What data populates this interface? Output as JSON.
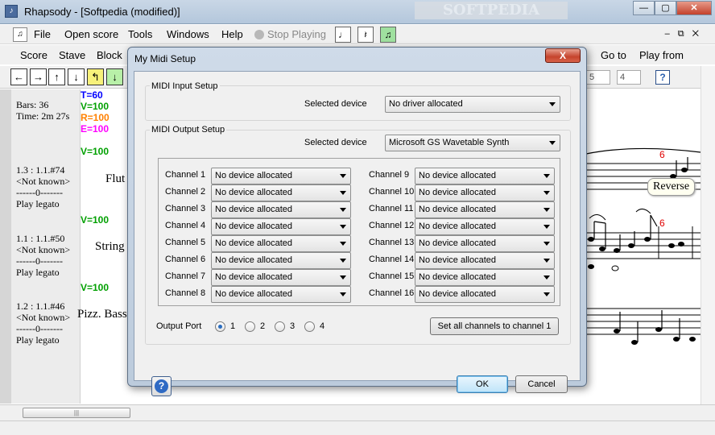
{
  "window": {
    "title": "Rhapsody - [Softpedia (modified)]",
    "watermark": "SOFTPEDIA"
  },
  "menubar": {
    "items": [
      "File",
      "Open score",
      "Tools",
      "Windows",
      "Help"
    ],
    "stop_playing": "Stop Playing",
    "note_buttons": [
      "♩",
      "𝄽",
      "♫"
    ]
  },
  "menu2": {
    "items": [
      "Score",
      "Stave",
      "Block"
    ],
    "right_items": [
      "Go to",
      "Play from"
    ]
  },
  "toolbar": {
    "buttons": [
      "←",
      "→",
      "↑",
      "↓",
      "↰",
      "↓"
    ],
    "spin1": "5",
    "spin2": "4",
    "help": "?"
  },
  "left_panel": {
    "bars": "Bars: 36",
    "time": "Time: 2m  27s",
    "blocks": [
      {
        "pos": "1.3 : 1.1.#74",
        "known": "<Not known>",
        "sep": "------0-------",
        "style": "Play legato"
      },
      {
        "pos": "1.1 : 1.1.#50",
        "known": "<Not known>",
        "sep": "------0-------",
        "style": "Play legato"
      },
      {
        "pos": "1.2 : 1.1.#46",
        "known": "<Not known>",
        "sep": "------0-------",
        "style": "Play legato"
      }
    ]
  },
  "score": {
    "tempo": "T=60",
    "velocity": "V=100",
    "r": "R=100",
    "e": "E=100",
    "v2": "V=100",
    "v3": "V=100",
    "v4": "V=100",
    "instruments": [
      "Flut",
      "String",
      "Pizz. Bass"
    ],
    "reverse_label": "Reverse",
    "marks": [
      "6",
      "6"
    ],
    "colors": {
      "tempo": "#0000ff",
      "velocity": "#00a000",
      "r": "#ff8000",
      "e": "#ff00ff",
      "mark": "#e00000"
    }
  },
  "dialog": {
    "title": "My Midi Setup",
    "close": "X",
    "input": {
      "group": "MIDI Input Setup",
      "label": "Selected device",
      "value": "No driver allocated"
    },
    "output": {
      "group": "MIDI Output Setup",
      "label": "Selected device",
      "value": "Microsoft GS Wavetable Synth"
    },
    "channels_left": [
      {
        "label": "Channel 1",
        "value": "No device allocated"
      },
      {
        "label": "Channel 2",
        "value": "No device allocated"
      },
      {
        "label": "Channel 3",
        "value": "No device allocated"
      },
      {
        "label": "Channel 4",
        "value": "No device allocated"
      },
      {
        "label": "Channel 5",
        "value": "No device allocated"
      },
      {
        "label": "Channel 6",
        "value": "No device allocated"
      },
      {
        "label": "Channel 7",
        "value": "No device allocated"
      },
      {
        "label": "Channel 8",
        "value": "No device allocated"
      }
    ],
    "channels_right": [
      {
        "label": "Channel 9",
        "value": "No device allocated"
      },
      {
        "label": "Channel 10",
        "value": "No device allocated"
      },
      {
        "label": "Channel 11",
        "value": "No device allocated"
      },
      {
        "label": "Channel 12",
        "value": "No device allocated"
      },
      {
        "label": "Channel 13",
        "value": "No device allocated"
      },
      {
        "label": "Channel 14",
        "value": "No device allocated"
      },
      {
        "label": "Channel 15",
        "value": "No device allocated"
      },
      {
        "label": "Channel 16",
        "value": "No device allocated"
      }
    ],
    "output_port": {
      "label": "Output Port",
      "options": [
        "1",
        "2",
        "3",
        "4"
      ],
      "selected": "1"
    },
    "set_all": "Set all channels to channel 1",
    "ok": "OK",
    "cancel": "Cancel",
    "help": "?"
  }
}
